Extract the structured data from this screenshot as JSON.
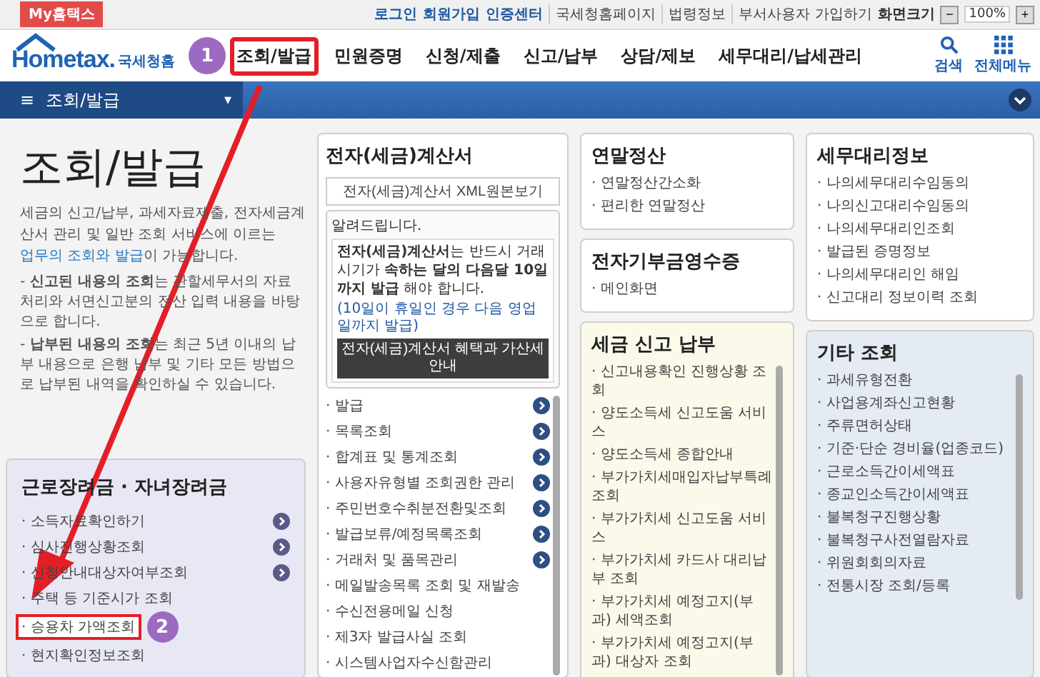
{
  "top_bar": {
    "badge": "My홈택스",
    "links": [
      {
        "label": "로그인",
        "kind": "strong"
      },
      {
        "label": "회원가입",
        "kind": "strong"
      },
      {
        "label": "인증센터",
        "kind": "strong"
      },
      {
        "label": "국세청홈페이지",
        "kind": "plain"
      },
      {
        "label": "법령정보",
        "kind": "plain"
      },
      {
        "label": "부서사용자 가입하기",
        "kind": "plain"
      }
    ],
    "zoom_label": "화면크기",
    "zoom_minus": "−",
    "zoom_value": "100%",
    "zoom_plus": "+"
  },
  "header": {
    "logo": "Hometax.",
    "logo_sub": "국세청홈",
    "nav": [
      {
        "label": "조회/발급",
        "highlighted": true,
        "marker": "1"
      },
      {
        "label": "민원증명",
        "highlighted": false
      },
      {
        "label": "신청/제출",
        "highlighted": false
      },
      {
        "label": "신고/납부",
        "highlighted": false
      },
      {
        "label": "상담/제보",
        "highlighted": false
      },
      {
        "label": "세무대리/납세관리",
        "highlighted": false
      }
    ],
    "tools": [
      {
        "label": "검색",
        "kind": "search"
      },
      {
        "label": "전체메뉴",
        "kind": "grid"
      }
    ]
  },
  "section_bar": {
    "menu_icon": "≡",
    "title": "조회/발급",
    "caret": "▾"
  },
  "intro": {
    "title": "조회/발급",
    "description_before": "세금의 신고/납부, 과세자료제출, 전자세금계산서 관리 및 일반 조회 서비스에 이르는 ",
    "description_link": "업무의 조회와 발급",
    "description_after": "이 가능합니다.",
    "notes": [
      "- **신고된 내용의 조회**는 관할세무서의 자료처리와 서면신고분의 전산 입력 내용을 바탕으로 합니다.",
      "- **납부된 내용의 조회**는 최근 5년 이내의 납부 내용으로 은행 납부 및 기타 모든 방법으로 납부된 내역을 확인하실 수 있습니다."
    ]
  },
  "left_box": {
    "title": "근로장려금 · 자녀장려금",
    "items": [
      {
        "label": "· 소득자료확인하기",
        "kind": "go",
        "highlighted": false
      },
      {
        "label": "· 심사진행상황조회",
        "kind": "go",
        "highlighted": false
      },
      {
        "label": "· 신청안내대상자여부조회",
        "kind": "go",
        "highlighted": false
      },
      {
        "label": "· 주택 등 기준시가 조회",
        "kind": "plain",
        "highlighted": false
      },
      {
        "label": "· 승용차 가액조회",
        "kind": "plain",
        "highlighted": true,
        "marker": "2"
      },
      {
        "label": "· 현지확인정보조회",
        "kind": "plain",
        "highlighted": false
      }
    ]
  },
  "einvoice": {
    "title": "전자(세금)계산서",
    "xml_button": "전자(세금)계산서 XML원본보기",
    "notice_title": "알려드립니다.",
    "notice_text": "**전자(세금)계산서**는 반드시 거래시기가 **속하는 달의 다음달 10일까지 발급** 해야 합니다.",
    "notice_small": "(10일이 휴일인 경우 다음 영업일까지 발급)",
    "notice_button": "전자(세금)계산서 혜택과 가산세 안내",
    "items": [
      {
        "label": "· 발급",
        "kind": "go"
      },
      {
        "label": "· 목록조회",
        "kind": "go"
      },
      {
        "label": "· 합계표 및 통계조회",
        "kind": "go"
      },
      {
        "label": "· 사용자유형별 조회권한 관리",
        "kind": "go"
      },
      {
        "label": "· 주민번호수취분전환및조회",
        "kind": "go"
      },
      {
        "label": "· 발급보류/예정목록조회",
        "kind": "go"
      },
      {
        "label": "· 거래처 및 품목관리",
        "kind": "go"
      },
      {
        "label": "· 메일발송목록 조회 및 재발송",
        "kind": "plain"
      },
      {
        "label": "· 수신전용메일 신청",
        "kind": "plain"
      },
      {
        "label": "· 제3자 발급사실 조회",
        "kind": "plain"
      },
      {
        "label": "· 시스템사업자수신함관리",
        "kind": "plain"
      }
    ]
  },
  "columns": [
    [
      {
        "title": "연말정산",
        "scroll": false,
        "items": [
          "· 연말정산간소화",
          "· 편리한 연말정산"
        ]
      },
      {
        "title": "전자기부금영수증",
        "scroll": false,
        "items": [
          "· 메인화면"
        ]
      },
      {
        "title": "세금 신고 납부",
        "scroll": true,
        "items": [
          "· 신고내용확인 진행상황 조회",
          "· 양도소득세 신고도움 서비스",
          "· 양도소득세 종합안내",
          "· 부가가치세매입자납부특례조회",
          "· 부가가치세 신고도움 서비스",
          "· 부가가치세 카드사 대리납부 조회",
          "· 부가가치세 예정고지(부과) 세액조회",
          "· 부가가치세 예정고지(부과) 대상자 조회"
        ]
      }
    ],
    [
      {
        "title": "세무대리정보",
        "scroll": false,
        "items": [
          "· 나의세무대리수임동의",
          "· 나의신고대리수임동의",
          "· 나의세무대리인조회",
          "· 발급된 증명정보",
          "· 나의세무대리인 해임",
          "· 신고대리 정보이력 조회"
        ]
      },
      {
        "title": "기타 조회",
        "scroll": true,
        "items": [
          "· 과세유형전환",
          "· 사업용계좌신고현황",
          "· 주류면허상태",
          "· 기준·단순 경비율(업종코드)",
          "· 근로소득간이세액표",
          "· 종교인소득간이세액표",
          "· 불복청구진행상황",
          "· 불복청구사전열람자료",
          "· 위원회회의자료",
          "· 전통시장 조회/등록"
        ]
      }
    ]
  ]
}
